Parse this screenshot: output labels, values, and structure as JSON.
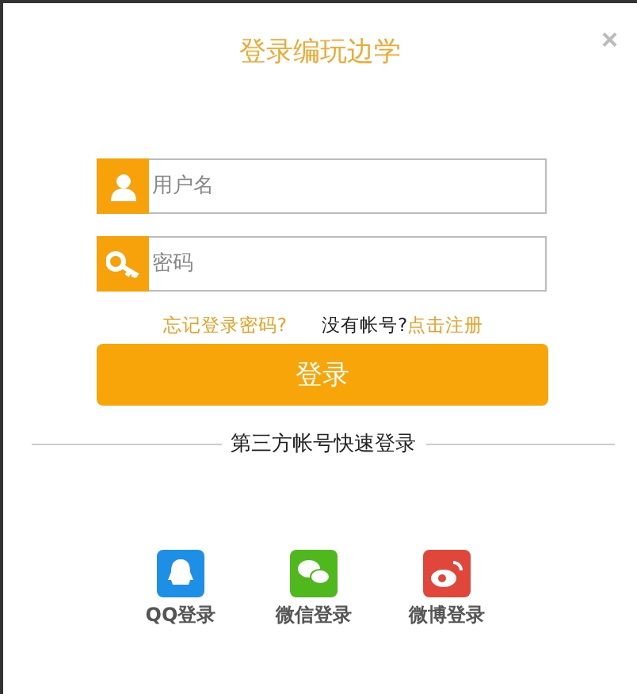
{
  "dialog": {
    "title": "登录编玩边学",
    "close": "×"
  },
  "fields": [
    {
      "kind": "user",
      "placeholder": "用户名"
    },
    {
      "kind": "key",
      "placeholder": "密码"
    }
  ],
  "links": {
    "forgot": "忘记登录密码?",
    "no_account": "没有帐号?",
    "register": "点击注册"
  },
  "login_button": "登录",
  "divider_text": "第三方帐号快速登录",
  "social": [
    {
      "kind": "qq",
      "label": "QQ登录"
    },
    {
      "kind": "wechat",
      "label": "微信登录"
    },
    {
      "kind": "weibo",
      "label": "微博登录"
    }
  ]
}
